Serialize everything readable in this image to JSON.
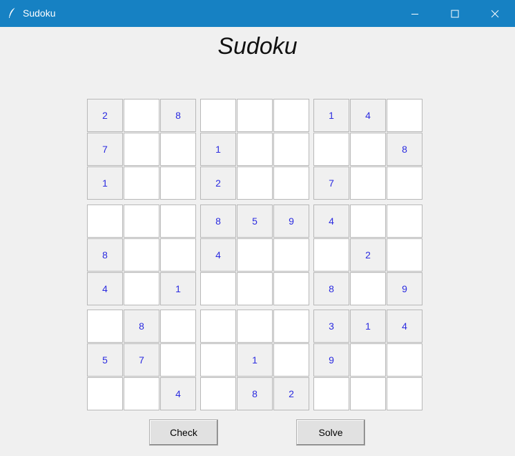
{
  "window": {
    "title": "Sudoku"
  },
  "heading": "Sudoku",
  "board": [
    [
      "2",
      "",
      "8",
      "",
      "",
      "",
      "1",
      "4",
      ""
    ],
    [
      "7",
      "",
      "",
      "1",
      "",
      "",
      "",
      "",
      "8"
    ],
    [
      "1",
      "",
      "",
      "2",
      "",
      "",
      "7",
      "",
      ""
    ],
    [
      "",
      "",
      "",
      "8",
      "5",
      "9",
      "4",
      "",
      ""
    ],
    [
      "8",
      "",
      "",
      "4",
      "",
      "",
      "",
      "2",
      ""
    ],
    [
      "4",
      "",
      "1",
      "",
      "",
      "",
      "8",
      "",
      "9"
    ],
    [
      "",
      "8",
      "",
      "",
      "",
      "",
      "3",
      "1",
      "4"
    ],
    [
      "5",
      "7",
      "",
      "",
      "1",
      "",
      "9",
      "",
      ""
    ],
    [
      "",
      "",
      "4",
      "",
      "8",
      "2",
      "",
      "",
      ""
    ]
  ],
  "buttons": {
    "check": "Check",
    "solve": "Solve"
  },
  "colors": {
    "titlebar": "#1681c3",
    "given_digit": "#2a2ae0",
    "given_cell_bg": "#f0f0f0",
    "empty_cell_bg": "#ffffff"
  }
}
